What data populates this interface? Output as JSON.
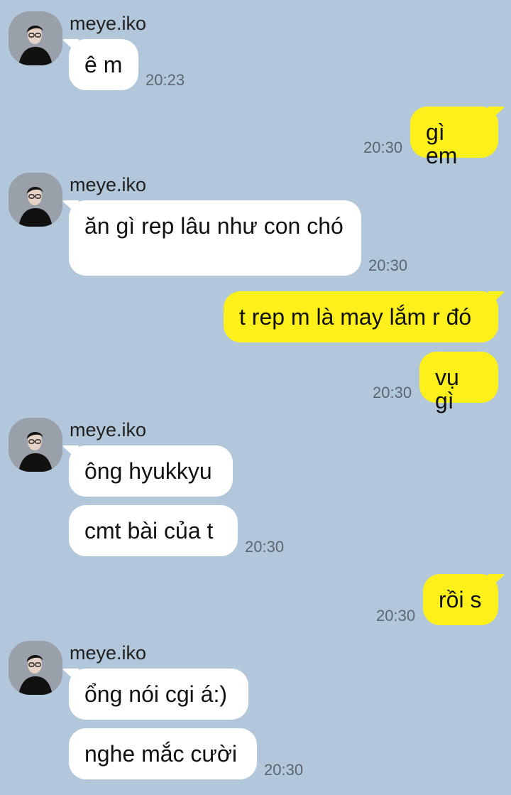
{
  "messages": [
    {
      "from": "other",
      "sender": "meye.iko",
      "text": "ê m",
      "time": "20:23"
    },
    {
      "from": "me",
      "text": "gì em",
      "time": "20:30"
    },
    {
      "from": "other",
      "sender": "meye.iko",
      "text": "ăn gì rep lâu như con chó",
      "time": "20:30"
    },
    {
      "from": "me",
      "text": "t rep m là may lắm r đó",
      "time": ""
    },
    {
      "from": "me",
      "text": "vụ gì",
      "time": "20:30"
    },
    {
      "from": "other",
      "sender": "meye.iko",
      "text": "ông hyukkyu",
      "time": ""
    },
    {
      "from": "other",
      "text": "cmt bài của t",
      "time": "20:30"
    },
    {
      "from": "me",
      "text": "rồi s",
      "time": "20:30"
    },
    {
      "from": "other",
      "sender": "meye.iko",
      "text": "ổng nói cgi á:)",
      "time": ""
    },
    {
      "from": "other",
      "text": "nghe mắc cười",
      "time": "20:30"
    }
  ],
  "colors": {
    "background": "#b2c7da",
    "incoming_bubble": "#ffffff",
    "outgoing_bubble": "#fef01b",
    "timestamp": "#5c6670"
  },
  "icons": {
    "avatar": "profile-photo-avatar"
  }
}
